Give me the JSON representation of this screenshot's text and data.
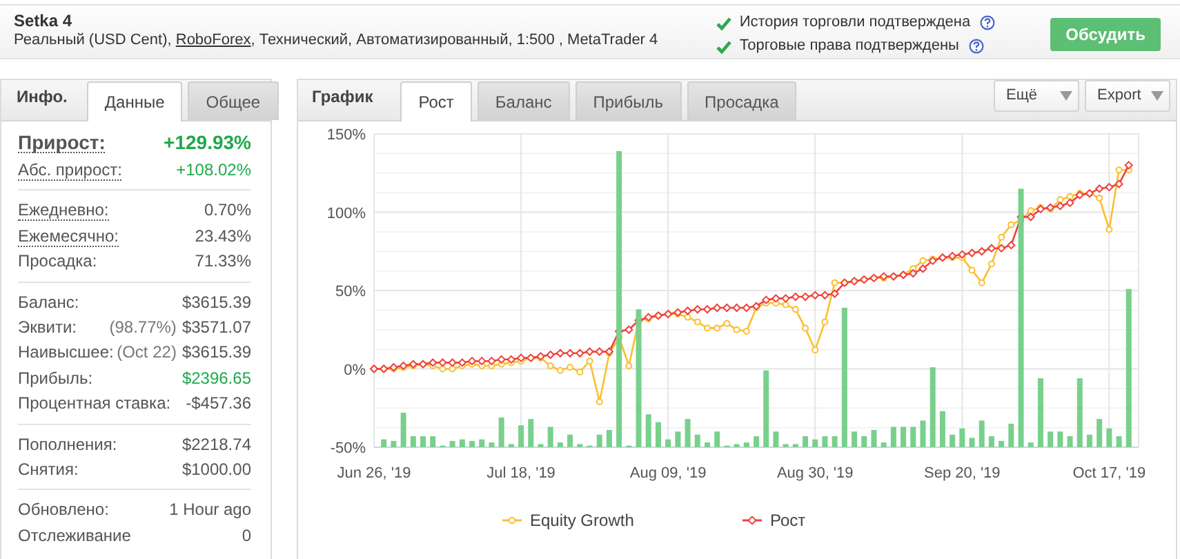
{
  "header": {
    "title": "Setka 4",
    "subtitle": {
      "before": "Реальный (USD Cent), ",
      "link": "RoboForex",
      "after": ", Технический, Автоматизированный, 1:500 , MetaTrader 4"
    },
    "verifications": [
      {
        "text": "История торговли подтверждена",
        "verified": true
      },
      {
        "text": "Торговые права подтверждены",
        "verified": true
      }
    ],
    "button": "Обсудить"
  },
  "info_panel": {
    "title": "Инфо.",
    "tabs": [
      {
        "label": "Данные",
        "selected": true
      },
      {
        "label": "Общее",
        "selected": false
      }
    ],
    "sections": [
      [
        {
          "label": "Прирост:",
          "value": "+129.93%",
          "kind": "big",
          "underlined": true,
          "positive": true
        },
        {
          "label": "Абс. прирост:",
          "value": "+108.02%",
          "kind": "normal",
          "underlined": true,
          "positive": true
        }
      ],
      [
        {
          "label": "Ежедневно:",
          "value": "0.70%",
          "kind": "normal",
          "underlined": true,
          "positive": false
        },
        {
          "label": "Ежемесячно:",
          "value": "23.43%",
          "kind": "normal",
          "underlined": true,
          "positive": false
        },
        {
          "label": "Просадка:",
          "value": "71.33%",
          "kind": "normal",
          "underlined": false,
          "positive": false
        }
      ],
      [
        {
          "label": "Баланс:",
          "value": "$3615.39",
          "kind": "normal",
          "underlined": false,
          "positive": false
        },
        {
          "label": "Эквити:",
          "note": "(98.77%)",
          "value": "$3571.07",
          "kind": "normal",
          "underlined": false,
          "positive": false
        },
        {
          "label": "Наивысшее:",
          "note": "(Oct 22)",
          "value": "$3615.39",
          "kind": "normal",
          "underlined": false,
          "positive": false
        },
        {
          "label": "Прибыль:",
          "value": "$2396.65",
          "kind": "normal",
          "underlined": false,
          "positive": true
        },
        {
          "label": "Процентная ставка:",
          "value": "-$457.36",
          "kind": "normal",
          "underlined": false,
          "positive": false
        }
      ],
      [
        {
          "label": "Пополнения:",
          "value": "$2218.74",
          "kind": "normal",
          "underlined": false,
          "positive": false
        },
        {
          "label": "Снятия:",
          "value": "$1000.00",
          "kind": "normal",
          "underlined": false,
          "positive": false
        }
      ],
      [
        {
          "label": "Обновлено:",
          "value": "1 Hour ago",
          "kind": "normal",
          "underlined": false,
          "positive": false
        },
        {
          "label": "Отслеживание",
          "value": "0",
          "kind": "normal",
          "underlined": false,
          "positive": false
        }
      ]
    ]
  },
  "chart_panel": {
    "title": "График",
    "tabs": [
      {
        "label": "Рост",
        "selected": true
      },
      {
        "label": "Баланс",
        "selected": false
      },
      {
        "label": "Прибыль",
        "selected": false
      },
      {
        "label": "Просадка",
        "selected": false
      }
    ],
    "dropdowns": [
      "Ещё",
      "Export"
    ],
    "chart_data": {
      "type": "line",
      "grid": true,
      "legend": "bottom",
      "ylim": [
        -50,
        150
      ],
      "categories": [
        "Jun 26, '19",
        null,
        null,
        null,
        null,
        null,
        null,
        null,
        null,
        null,
        null,
        null,
        null,
        null,
        null,
        "Jul 18, '19",
        null,
        null,
        null,
        null,
        null,
        null,
        null,
        null,
        null,
        null,
        null,
        null,
        null,
        null,
        "Aug 09, '19",
        null,
        null,
        null,
        null,
        null,
        null,
        null,
        null,
        null,
        null,
        null,
        null,
        null,
        null,
        "Aug 30, '19",
        null,
        null,
        null,
        null,
        null,
        null,
        null,
        null,
        null,
        null,
        null,
        null,
        null,
        null,
        "Sep 20, '19",
        null,
        null,
        null,
        null,
        null,
        null,
        null,
        null,
        null,
        null,
        null,
        null,
        null,
        null,
        "Oct 17, '19",
        null,
        null
      ],
      "yticks": [
        {
          "value": 150,
          "label": "150%"
        },
        {
          "value": 100,
          "label": "100%"
        },
        {
          "value": 50,
          "label": "50%"
        },
        {
          "value": 0,
          "label": "0%"
        },
        {
          "value": -50,
          "label": "-50%"
        }
      ],
      "series": [
        {
          "name": "Equity Growth",
          "color": "#fbbf2e",
          "marker": "circle",
          "values": [
            0,
            0,
            0,
            1,
            2,
            3,
            2,
            0,
            0,
            2,
            3,
            2,
            2,
            3,
            4,
            5,
            7,
            7,
            2,
            -1,
            1,
            -2,
            5,
            -21,
            10,
            20,
            2,
            31,
            32,
            34,
            35,
            35,
            33,
            30,
            26,
            26,
            29,
            25,
            24,
            39,
            42,
            42,
            41,
            38,
            26,
            12,
            30,
            55,
            55,
            56,
            57,
            58,
            58,
            59,
            60,
            64,
            69,
            70,
            71,
            71,
            71,
            63,
            55,
            67,
            84,
            92,
            95,
            101,
            103,
            102,
            108,
            110,
            112,
            112,
            109,
            89,
            127,
            127
          ]
        },
        {
          "name": "Рост",
          "color": "#f0413c",
          "marker": "diamond",
          "values": [
            0,
            0,
            1,
            2,
            3,
            3,
            4,
            4,
            4,
            4,
            5,
            5,
            5,
            6,
            6,
            7,
            7,
            8,
            9,
            10,
            10,
            10,
            11,
            11,
            11,
            24,
            25,
            31,
            33,
            34,
            35,
            36,
            37,
            38,
            38,
            39,
            39,
            39,
            39,
            40,
            44,
            45,
            45,
            46,
            46,
            47,
            47,
            48,
            55,
            56,
            57,
            58,
            59,
            59,
            60,
            61,
            64,
            69,
            71,
            72,
            73,
            74,
            75,
            77,
            77,
            79,
            97,
            97,
            102,
            103,
            104,
            106,
            111,
            112,
            115,
            116,
            118,
            130
          ]
        }
      ]
    }
  }
}
